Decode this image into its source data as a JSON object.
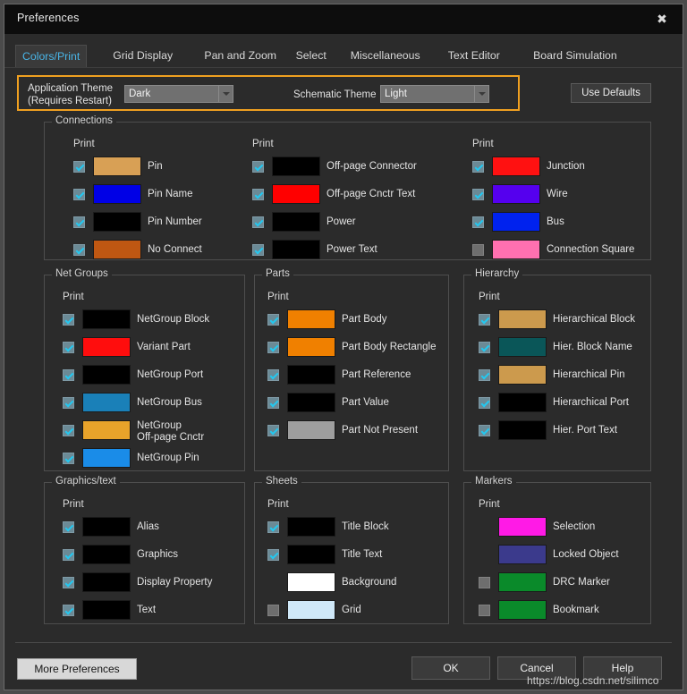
{
  "window": {
    "title": "Preferences",
    "close_icon": "close-icon"
  },
  "tabs": [
    {
      "label": "Colors/Print",
      "active": true
    },
    {
      "label": "Grid Display",
      "active": false
    },
    {
      "label": "Pan and Zoom",
      "active": false
    },
    {
      "label": "Select",
      "active": false
    },
    {
      "label": "Miscellaneous",
      "active": false
    },
    {
      "label": "Text Editor",
      "active": false
    },
    {
      "label": "Board Simulation",
      "active": false
    }
  ],
  "theme_bar": {
    "app_theme_label_line1": "Application Theme",
    "app_theme_label_line2": "(Requires Restart)",
    "app_theme_value": "Dark",
    "schematic_theme_label": "Schematic Theme",
    "schematic_theme_value": "Light",
    "use_defaults_label": "Use Defaults",
    "highlight_color": "#f0a020"
  },
  "print_label": "Print",
  "groups": [
    {
      "name": "connections",
      "title": "Connections",
      "columns": [
        {
          "rows": [
            {
              "label": "Pin",
              "color": "#d8a055",
              "checkbox": "on"
            },
            {
              "label": "Pin Name",
              "color": "#0000e6",
              "checkbox": "on"
            },
            {
              "label": "Pin Number",
              "color": "#000000",
              "checkbox": "on"
            },
            {
              "label": "No Connect",
              "color": "#bf5712",
              "checkbox": "on"
            }
          ]
        },
        {
          "rows": [
            {
              "label": "Off-page Connector",
              "color": "#000000",
              "checkbox": "on"
            },
            {
              "label": "Off-page Cnctr Text",
              "color": "#ff0000",
              "checkbox": "on"
            },
            {
              "label": "Power",
              "color": "#000000",
              "checkbox": "on"
            },
            {
              "label": "Power Text",
              "color": "#000000",
              "checkbox": "on"
            }
          ]
        },
        {
          "rows": [
            {
              "label": "Junction",
              "color": "#ff1111",
              "checkbox": "on"
            },
            {
              "label": "Wire",
              "color": "#5500ee",
              "checkbox": "on"
            },
            {
              "label": "Bus",
              "color": "#0022ee",
              "checkbox": "on"
            },
            {
              "label": "Connection Square",
              "color": "#ff70b0",
              "checkbox": "off"
            }
          ]
        }
      ]
    },
    {
      "name": "net-groups",
      "title": "Net Groups",
      "columns": [
        {
          "rows": [
            {
              "label": "NetGroup Block",
              "color": "#000000",
              "checkbox": "on"
            },
            {
              "label": "Variant Part",
              "color": "#ff0d0d",
              "checkbox": "on"
            },
            {
              "label": "NetGroup Port",
              "color": "#000000",
              "checkbox": "on"
            },
            {
              "label": "NetGroup Bus",
              "color": "#1a80b8",
              "checkbox": "on"
            },
            {
              "label": "NetGroup\nOff-page Cnctr",
              "color": "#e8a32a",
              "checkbox": "on"
            },
            {
              "label": "NetGroup Pin",
              "color": "#1a8ce8",
              "checkbox": "on"
            }
          ]
        }
      ]
    },
    {
      "name": "parts",
      "title": "Parts",
      "columns": [
        {
          "rows": [
            {
              "label": "Part Body",
              "color": "#f08000",
              "checkbox": "on"
            },
            {
              "label": "Part Body Rectangle",
              "color": "#f08000",
              "checkbox": "on"
            },
            {
              "label": "Part Reference",
              "color": "#000000",
              "checkbox": "on"
            },
            {
              "label": "Part Value",
              "color": "#000000",
              "checkbox": "on"
            },
            {
              "label": "Part Not Present",
              "color": "#9e9e9e",
              "checkbox": "on"
            }
          ]
        }
      ]
    },
    {
      "name": "hierarchy",
      "title": "Hierarchy",
      "columns": [
        {
          "rows": [
            {
              "label": "Hierarchical Block",
              "color": "#cc9a4d",
              "checkbox": "on"
            },
            {
              "label": "Hier. Block Name",
              "color": "#0a5658",
              "checkbox": "on"
            },
            {
              "label": "Hierarchical Pin",
              "color": "#cc9a4d",
              "checkbox": "on"
            },
            {
              "label": "Hierarchical Port",
              "color": "#000000",
              "checkbox": "on"
            },
            {
              "label": "Hier. Port Text",
              "color": "#000000",
              "checkbox": "on"
            }
          ]
        }
      ]
    },
    {
      "name": "graphics-text",
      "title": "Graphics/text",
      "columns": [
        {
          "rows": [
            {
              "label": "Alias",
              "color": "#000000",
              "checkbox": "on"
            },
            {
              "label": "Graphics",
              "color": "#000000",
              "checkbox": "on"
            },
            {
              "label": "Display Property",
              "color": "#000000",
              "checkbox": "on"
            },
            {
              "label": "Text",
              "color": "#000000",
              "checkbox": "on"
            }
          ]
        }
      ]
    },
    {
      "name": "sheets",
      "title": "Sheets",
      "columns": [
        {
          "rows": [
            {
              "label": "Title Block",
              "color": "#000000",
              "checkbox": "on"
            },
            {
              "label": "Title Text",
              "color": "#000000",
              "checkbox": "on"
            },
            {
              "label": "Background",
              "color": "#ffffff",
              "checkbox": "none"
            },
            {
              "label": "Grid",
              "color": "#cfe8f8",
              "checkbox": "off"
            }
          ]
        }
      ]
    },
    {
      "name": "markers",
      "title": "Markers",
      "columns": [
        {
          "rows": [
            {
              "label": "Selection",
              "color": "#ff1ae6",
              "checkbox": "none"
            },
            {
              "label": "Locked Object",
              "color": "#3b3a8c",
              "checkbox": "none"
            },
            {
              "label": "DRC Marker",
              "color": "#0a8a2a",
              "checkbox": "off"
            },
            {
              "label": "Bookmark",
              "color": "#0a8a2a",
              "checkbox": "off"
            }
          ]
        }
      ]
    }
  ],
  "footer": {
    "more_preferences_label": "More Preferences",
    "ok_label": "OK",
    "cancel_label": "Cancel",
    "help_label": "Help"
  },
  "watermark": "https://blog.csdn.net/silimco"
}
